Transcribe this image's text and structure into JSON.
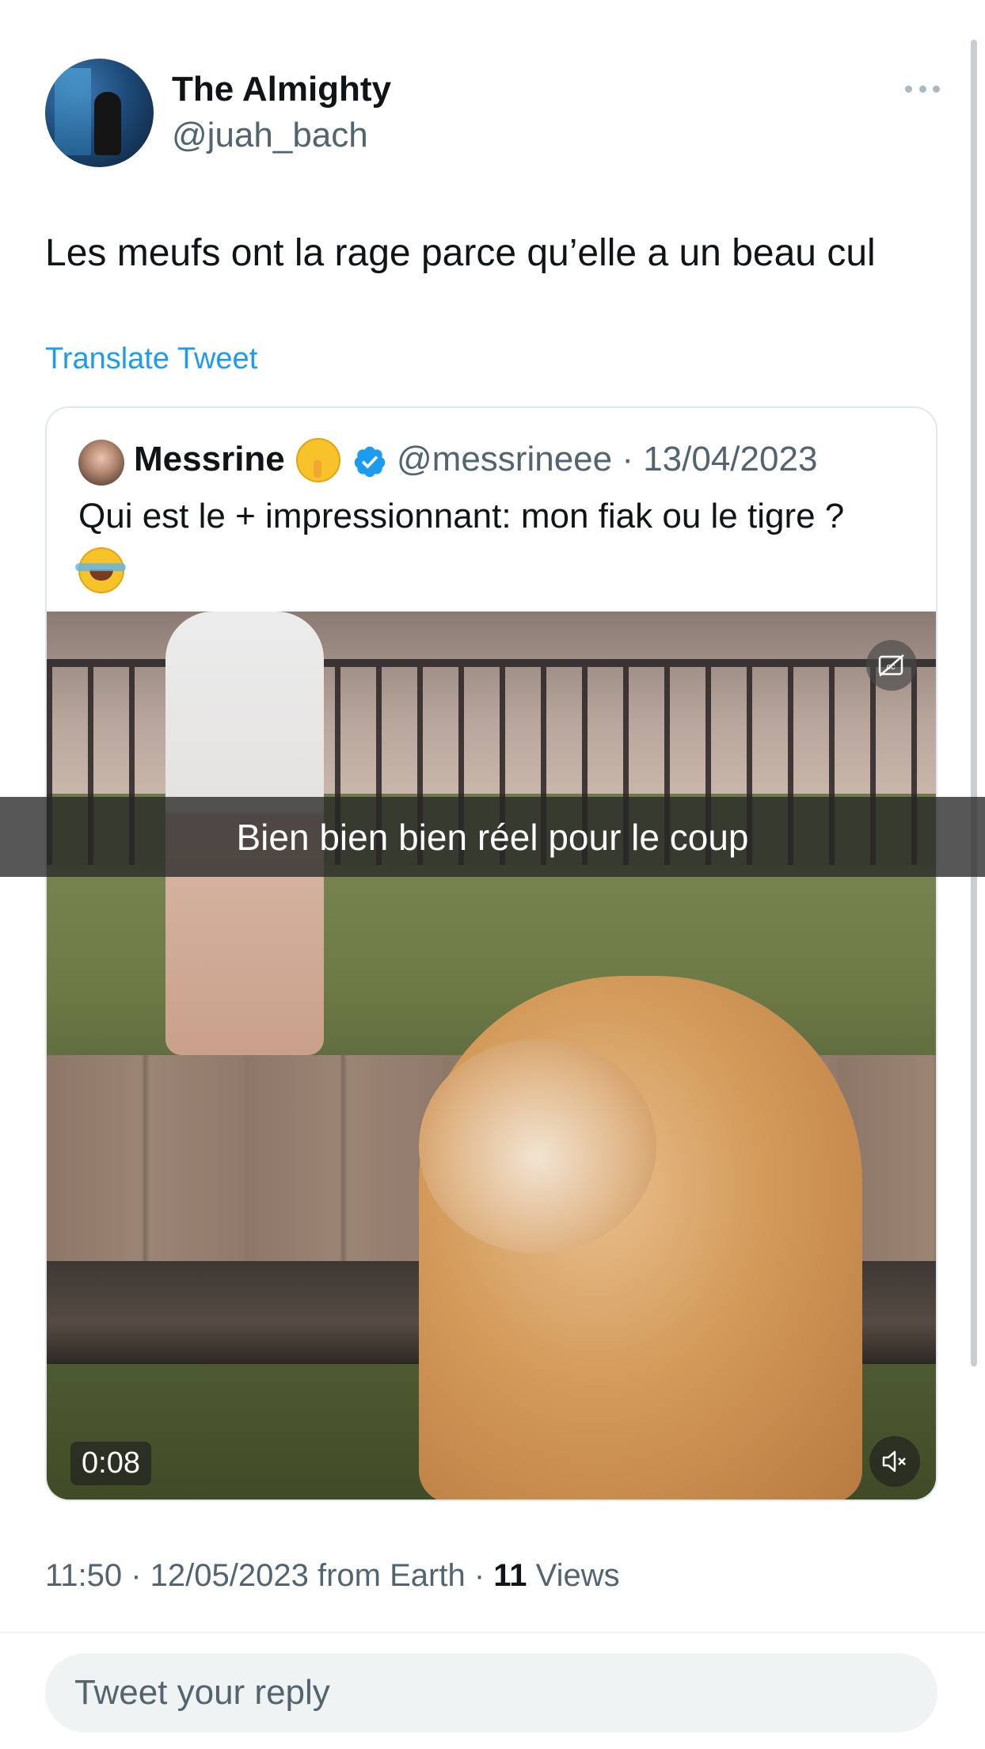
{
  "tweet": {
    "author": {
      "name": "The Almighty",
      "handle": "@juah_bach",
      "avatar_icon": "profile-photo"
    },
    "more_icon": "more-horizontal-icon",
    "text": "Les meufs ont la rage parce qu’elle a un beau cul",
    "translate_label": "Translate Tweet",
    "meta": {
      "time_date_source": "11:50 · 12/05/2023 from Earth · ",
      "views_count": "11",
      "views_label": " Views"
    }
  },
  "quoted_tweet": {
    "author_name": "Messrine",
    "author_emoji": "shushing-face-emoji",
    "verified_icon": "verified-badge-icon",
    "handle_date": "@messrineee · 13/04/2023",
    "text": "Qui est le + impressionnant: mon fiak ou le tigre ?",
    "text_emoji": "tears-of-joy-emoji",
    "video": {
      "caption": "Bien bien bien réel pour le coup",
      "duration": "0:08",
      "captions_icon": "closed-captions-icon",
      "mute_icon": "volume-muted-icon"
    }
  },
  "reply": {
    "placeholder": "Tweet your reply"
  },
  "colors": {
    "accent": "#1d9bf0",
    "text_primary": "#0f1419",
    "text_secondary": "#536471",
    "reply_bg": "#eff3f4"
  }
}
